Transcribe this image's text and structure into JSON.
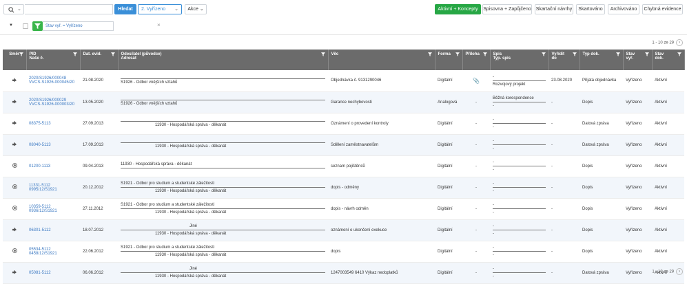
{
  "toolbar": {
    "search_button": "Hledat",
    "search_placeholder": "",
    "status_select": "2. Vyřízeno",
    "actions": "Akce",
    "buttons": [
      "Aktivní + Koncepty",
      "Spisovna + Zapůjčeno",
      "Skartační návrhy",
      "Skartováno",
      "Archivováno",
      "Chybná evidence"
    ],
    "accent": "#3a8fd8",
    "green": "#27a745"
  },
  "filter": {
    "tag": "Stav vyř. = Vyřízeno",
    "close": "×"
  },
  "pager": {
    "text": "1 - 10 ze 29",
    "arrow": "›"
  },
  "table": {
    "headers": [
      {
        "l1": "Směr",
        "l2": ""
      },
      {
        "l1": "PID",
        "l2": "Naše č."
      },
      {
        "l1": "Dat. evid.",
        "l2": ""
      },
      {
        "l1": "Odesílatel (původce)",
        "l2": "Adresát"
      },
      {
        "l1": "Věc",
        "l2": ""
      },
      {
        "l1": "Forma",
        "l2": ""
      },
      {
        "l1": "Příloha",
        "l2": ""
      },
      {
        "l1": "Spis",
        "l2": "Typ. spis"
      },
      {
        "l1": "Vyřídit",
        "l2": "do"
      },
      {
        "l1": "Typ dok.",
        "l2": ""
      },
      {
        "l1": "Stav",
        "l2": "vyř."
      },
      {
        "l1": "Stav",
        "l2": "dok."
      }
    ],
    "rows": [
      {
        "smer": "in",
        "pid": "2020/S1926/000048",
        "nase": "VVCS-S1926-000045/20",
        "dat": "21.08.2020",
        "odes": "",
        "adres": "S1926 - Odbor vnějších vztahů",
        "vec": "Objednávka č. 9131290046",
        "forma": "Digitální",
        "priloha": "clip",
        "spis": "-",
        "typspis": "Rozvojový projekt",
        "vyridit": "23.08.2020",
        "typdok": "Přijatá objednávka",
        "stavvyr": "Vyřízeno",
        "stavdok": "Aktivní"
      },
      {
        "smer": "in",
        "pid": "2020/S1926/000029",
        "nase": "VVCS-S1926-000003/20",
        "dat": "13.05.2020",
        "odes": "",
        "adres": "S1926 - Odbor vnějších vztahů",
        "vec": "Garance nechybovosti",
        "forma": "Analogová",
        "priloha": "-",
        "spis": "Běžná korespondence",
        "typspis": "-",
        "vyridit": "-",
        "typdok": "Dopis",
        "stavvyr": "Vyřízeno",
        "stavdok": "Aktivní"
      },
      {
        "smer": "in",
        "pid": "08375-5113",
        "nase": "",
        "dat": "27.09.2013",
        "odes": "",
        "adres": "11930 - Hospodářská správa - děkanát",
        "vec": "Oznámení o provedení kontroly",
        "forma": "Digitální",
        "priloha": "-",
        "spis": "-",
        "typspis": "-",
        "vyridit": "-",
        "typdok": "Datová zpráva",
        "stavvyr": "Vyřízeno",
        "stavdok": "Aktivní"
      },
      {
        "smer": "in",
        "pid": "08040-5113",
        "nase": "",
        "dat": "17.09.2013",
        "odes": "",
        "adres": "11930 - Hospodářská správa - děkanát",
        "vec": "Sdělení zaměstnavatelům",
        "forma": "Digitální",
        "priloha": "-",
        "spis": "-",
        "typspis": "-",
        "vyridit": "-",
        "typdok": "Datová zpráva",
        "stavvyr": "Vyřízeno",
        "stavdok": "Aktivní"
      },
      {
        "smer": "out",
        "pid": "01200-1113",
        "nase": "",
        "dat": "09.04.2013",
        "odes": "11930 - Hospodářská správa - děkanát",
        "adres": "",
        "vec": "seznam pojištěnců",
        "forma": "Digitální",
        "priloha": "-",
        "spis": "-",
        "typspis": "-",
        "vyridit": "-",
        "typdok": "Dopis",
        "stavvyr": "Vyřízeno",
        "stavdok": "Aktivní"
      },
      {
        "smer": "out",
        "pid": "11331-5112",
        "nase": "0995/12/S1921",
        "dat": "20.12.2012",
        "odes": "S1921 - Odbor pro studium a studentské záležitosti",
        "adres": "11930 - Hospodářská správa - děkanát",
        "vec": "dopis - odměny",
        "forma": "Digitální",
        "priloha": "-",
        "spis": "-",
        "typspis": "-",
        "vyridit": "-",
        "typdok": "Dopis",
        "stavvyr": "Vyřízeno",
        "stavdok": "Aktivní"
      },
      {
        "smer": "out",
        "pid": "10359-5112",
        "nase": "0936/12/S1921",
        "dat": "27.11.2012",
        "odes": "S1921 - Odbor pro studium a studentské záležitosti",
        "adres": "11930 - Hospodářská správa - děkanát",
        "vec": "dopis - návrh odměn",
        "forma": "Digitální",
        "priloha": "-",
        "spis": "-",
        "typspis": "-",
        "vyridit": "-",
        "typdok": "Dopis",
        "stavvyr": "Vyřízeno",
        "stavdok": "Aktivní"
      },
      {
        "smer": "in",
        "pid": "06301-5112",
        "nase": "",
        "dat": "18.07.2012",
        "odes": "Jiné",
        "adres": "11930 - Hospodářská správa - děkanát",
        "vec": "oznámení o ukončení exekuce",
        "forma": "Digitální",
        "priloha": "-",
        "spis": "-",
        "typspis": "-",
        "vyridit": "-",
        "typdok": "Dopis",
        "stavvyr": "Vyřízeno",
        "stavdok": "Aktivní"
      },
      {
        "smer": "out",
        "pid": "05534-5112",
        "nase": "0458/12/S1921",
        "dat": "22.06.2012",
        "odes": "S1921 - Odbor pro studium a studentské záležitosti",
        "adres": "11930 - Hospodářská správa - děkanát",
        "vec": "dopis",
        "forma": "Digitální",
        "priloha": "-",
        "spis": "-",
        "typspis": "-",
        "vyridit": "-",
        "typdok": "Dopis",
        "stavvyr": "Vyřízeno",
        "stavdok": "Aktivní"
      },
      {
        "smer": "in",
        "pid": "05081-5112",
        "nase": "",
        "dat": "06.06.2012",
        "odes": "Jiné",
        "adres": "11930 - Hospodářská správa - děkanát",
        "vec": "1247003549 6410 Výkaz nedoplatků",
        "forma": "Digitální",
        "priloha": "-",
        "spis": "-",
        "typspis": "-",
        "vyridit": "-",
        "typdok": "Datová zpráva",
        "stavvyr": "Vyřízeno",
        "stavdok": "Aktivní"
      }
    ]
  }
}
